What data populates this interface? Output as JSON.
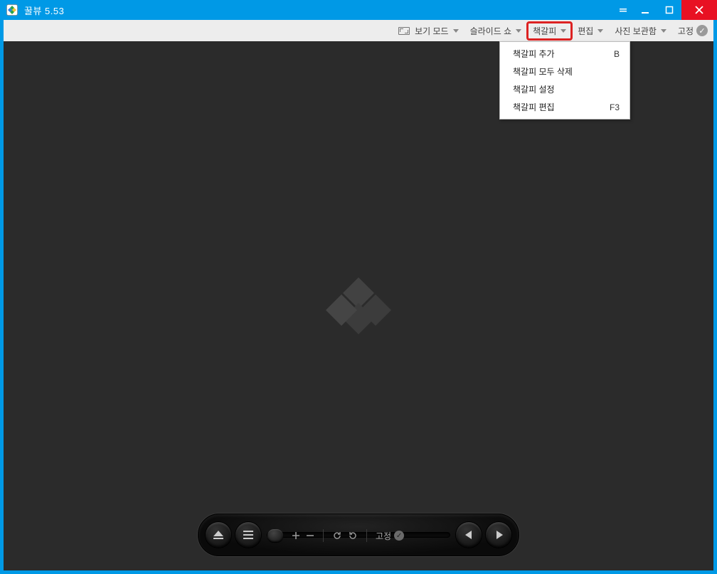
{
  "titlebar": {
    "app_name": "꿀뷰",
    "version": "5.53"
  },
  "toolbar": {
    "view_mode": "보기 모드",
    "slideshow": "슬라이드 쇼",
    "bookmark": "책갈피",
    "edit": "편집",
    "photo_storage": "사진 보관함",
    "pin": "고정"
  },
  "bookmark_menu": {
    "items": [
      {
        "label": "책갈피 추가",
        "shortcut": "B"
      },
      {
        "label": "책갈피 모두 삭제",
        "shortcut": ""
      },
      {
        "label": "책갈피 설정",
        "shortcut": ""
      },
      {
        "label": "책갈피 편집",
        "shortcut": "F3"
      }
    ]
  },
  "bottom_bar": {
    "pin_label": "고정"
  }
}
